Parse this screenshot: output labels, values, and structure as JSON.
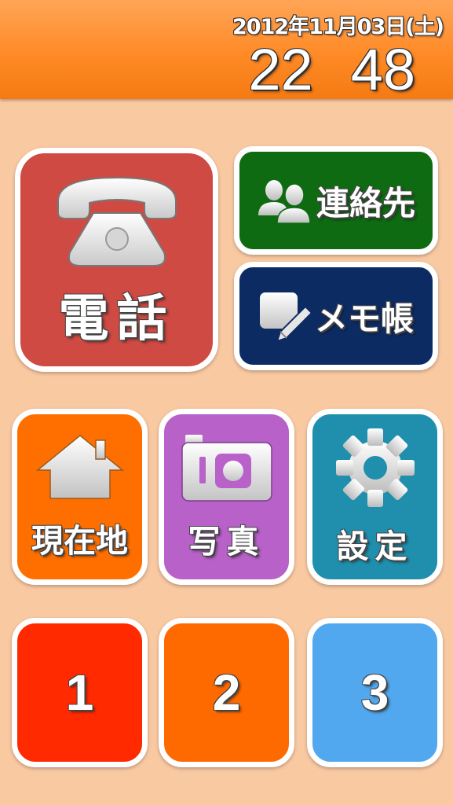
{
  "header": {
    "date": "2012年11月03日(土)",
    "time_hour": "22",
    "time_minute": "48"
  },
  "tiles": {
    "phone": {
      "label": "電話",
      "icon": "phone-icon",
      "color": "#cf4a43"
    },
    "contacts": {
      "label": "連絡先",
      "icon": "contacts-icon",
      "color": "#0e6b12"
    },
    "memo": {
      "label": "メモ帳",
      "icon": "memo-pencil-icon",
      "color": "#0d2b63"
    },
    "location": {
      "label": "現在地",
      "icon": "house-icon",
      "color": "#ff6f00"
    },
    "photo": {
      "label": "写真",
      "icon": "camera-icon",
      "color": "#b761c9"
    },
    "settings": {
      "label": "設定",
      "icon": "gear-icon",
      "color": "#1f8fad"
    }
  },
  "speed_dial": [
    {
      "label": "1",
      "color": "#ff2a00"
    },
    {
      "label": "2",
      "color": "#ff6a00"
    },
    {
      "label": "3",
      "color": "#52a8ee"
    }
  ],
  "colors": {
    "background": "#f9c9a2",
    "header": "#ff8a26"
  }
}
